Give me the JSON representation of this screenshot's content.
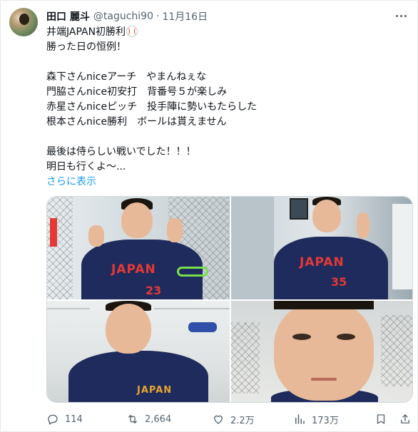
{
  "tweet": {
    "author_name": "田口 麗斗",
    "handle": "@taguchi90",
    "separator": "·",
    "date": "11月16日",
    "lines": [
      "井端JAPAN初勝利",
      "勝った日の恒例！",
      "",
      "森下さんniceアーチ　やまんねぇな",
      "門脇さんnice初安打　背番号５が楽しみ",
      "赤星さんniceピッチ　投手陣に勢いもたらした",
      "根本さんnice勝利　ボールは貰えません",
      "",
      "最後は侍らしい戦いでした！！！",
      "明日も行くよ～..."
    ],
    "show_more": "さらに表示"
  },
  "photos": {
    "photo1": {
      "jersey_text": "JAPAN",
      "number": "23"
    },
    "photo2": {
      "jersey_text": "JAPAN",
      "number": "35"
    },
    "photo3": {
      "jersey_text": "JAPAN"
    }
  },
  "actions": {
    "reply_count": "114",
    "retweet_count": "2,664",
    "like_count": "2.2万",
    "views_count": "173万"
  },
  "icons": [
    "avatar",
    "more-icon",
    "baseball-icon",
    "reply-icon",
    "retweet-icon",
    "like-icon",
    "views-icon",
    "bookmark-icon",
    "share-icon"
  ],
  "colors": {
    "link": "#1d9bf0",
    "secondary_text": "#536471",
    "jersey_navy": "#1e2b5c",
    "jersey_red": "#e53935"
  }
}
